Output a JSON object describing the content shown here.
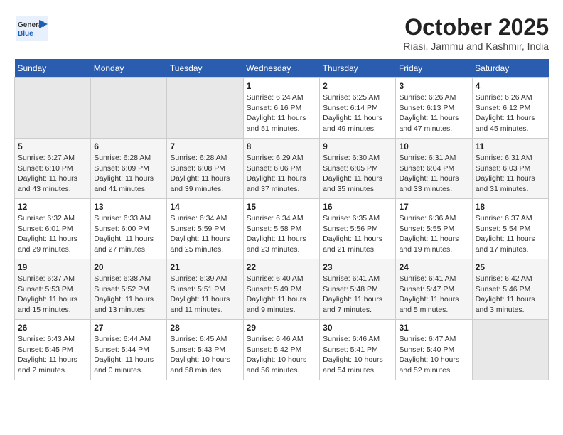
{
  "header": {
    "logo": {
      "general": "General",
      "blue": "Blue"
    },
    "title": "October 2025",
    "location": "Riasi, Jammu and Kashmir, India"
  },
  "calendar": {
    "days_of_week": [
      "Sunday",
      "Monday",
      "Tuesday",
      "Wednesday",
      "Thursday",
      "Friday",
      "Saturday"
    ],
    "weeks": [
      [
        {
          "day": "",
          "sunrise": "",
          "sunset": "",
          "daylight": ""
        },
        {
          "day": "",
          "sunrise": "",
          "sunset": "",
          "daylight": ""
        },
        {
          "day": "",
          "sunrise": "",
          "sunset": "",
          "daylight": ""
        },
        {
          "day": "1",
          "sunrise": "Sunrise: 6:24 AM",
          "sunset": "Sunset: 6:16 PM",
          "daylight": "Daylight: 11 hours and 51 minutes."
        },
        {
          "day": "2",
          "sunrise": "Sunrise: 6:25 AM",
          "sunset": "Sunset: 6:14 PM",
          "daylight": "Daylight: 11 hours and 49 minutes."
        },
        {
          "day": "3",
          "sunrise": "Sunrise: 6:26 AM",
          "sunset": "Sunset: 6:13 PM",
          "daylight": "Daylight: 11 hours and 47 minutes."
        },
        {
          "day": "4",
          "sunrise": "Sunrise: 6:26 AM",
          "sunset": "Sunset: 6:12 PM",
          "daylight": "Daylight: 11 hours and 45 minutes."
        }
      ],
      [
        {
          "day": "5",
          "sunrise": "Sunrise: 6:27 AM",
          "sunset": "Sunset: 6:10 PM",
          "daylight": "Daylight: 11 hours and 43 minutes."
        },
        {
          "day": "6",
          "sunrise": "Sunrise: 6:28 AM",
          "sunset": "Sunset: 6:09 PM",
          "daylight": "Daylight: 11 hours and 41 minutes."
        },
        {
          "day": "7",
          "sunrise": "Sunrise: 6:28 AM",
          "sunset": "Sunset: 6:08 PM",
          "daylight": "Daylight: 11 hours and 39 minutes."
        },
        {
          "day": "8",
          "sunrise": "Sunrise: 6:29 AM",
          "sunset": "Sunset: 6:06 PM",
          "daylight": "Daylight: 11 hours and 37 minutes."
        },
        {
          "day": "9",
          "sunrise": "Sunrise: 6:30 AM",
          "sunset": "Sunset: 6:05 PM",
          "daylight": "Daylight: 11 hours and 35 minutes."
        },
        {
          "day": "10",
          "sunrise": "Sunrise: 6:31 AM",
          "sunset": "Sunset: 6:04 PM",
          "daylight": "Daylight: 11 hours and 33 minutes."
        },
        {
          "day": "11",
          "sunrise": "Sunrise: 6:31 AM",
          "sunset": "Sunset: 6:03 PM",
          "daylight": "Daylight: 11 hours and 31 minutes."
        }
      ],
      [
        {
          "day": "12",
          "sunrise": "Sunrise: 6:32 AM",
          "sunset": "Sunset: 6:01 PM",
          "daylight": "Daylight: 11 hours and 29 minutes."
        },
        {
          "day": "13",
          "sunrise": "Sunrise: 6:33 AM",
          "sunset": "Sunset: 6:00 PM",
          "daylight": "Daylight: 11 hours and 27 minutes."
        },
        {
          "day": "14",
          "sunrise": "Sunrise: 6:34 AM",
          "sunset": "Sunset: 5:59 PM",
          "daylight": "Daylight: 11 hours and 25 minutes."
        },
        {
          "day": "15",
          "sunrise": "Sunrise: 6:34 AM",
          "sunset": "Sunset: 5:58 PM",
          "daylight": "Daylight: 11 hours and 23 minutes."
        },
        {
          "day": "16",
          "sunrise": "Sunrise: 6:35 AM",
          "sunset": "Sunset: 5:56 PM",
          "daylight": "Daylight: 11 hours and 21 minutes."
        },
        {
          "day": "17",
          "sunrise": "Sunrise: 6:36 AM",
          "sunset": "Sunset: 5:55 PM",
          "daylight": "Daylight: 11 hours and 19 minutes."
        },
        {
          "day": "18",
          "sunrise": "Sunrise: 6:37 AM",
          "sunset": "Sunset: 5:54 PM",
          "daylight": "Daylight: 11 hours and 17 minutes."
        }
      ],
      [
        {
          "day": "19",
          "sunrise": "Sunrise: 6:37 AM",
          "sunset": "Sunset: 5:53 PM",
          "daylight": "Daylight: 11 hours and 15 minutes."
        },
        {
          "day": "20",
          "sunrise": "Sunrise: 6:38 AM",
          "sunset": "Sunset: 5:52 PM",
          "daylight": "Daylight: 11 hours and 13 minutes."
        },
        {
          "day": "21",
          "sunrise": "Sunrise: 6:39 AM",
          "sunset": "Sunset: 5:51 PM",
          "daylight": "Daylight: 11 hours and 11 minutes."
        },
        {
          "day": "22",
          "sunrise": "Sunrise: 6:40 AM",
          "sunset": "Sunset: 5:49 PM",
          "daylight": "Daylight: 11 hours and 9 minutes."
        },
        {
          "day": "23",
          "sunrise": "Sunrise: 6:41 AM",
          "sunset": "Sunset: 5:48 PM",
          "daylight": "Daylight: 11 hours and 7 minutes."
        },
        {
          "day": "24",
          "sunrise": "Sunrise: 6:41 AM",
          "sunset": "Sunset: 5:47 PM",
          "daylight": "Daylight: 11 hours and 5 minutes."
        },
        {
          "day": "25",
          "sunrise": "Sunrise: 6:42 AM",
          "sunset": "Sunset: 5:46 PM",
          "daylight": "Daylight: 11 hours and 3 minutes."
        }
      ],
      [
        {
          "day": "26",
          "sunrise": "Sunrise: 6:43 AM",
          "sunset": "Sunset: 5:45 PM",
          "daylight": "Daylight: 11 hours and 2 minutes."
        },
        {
          "day": "27",
          "sunrise": "Sunrise: 6:44 AM",
          "sunset": "Sunset: 5:44 PM",
          "daylight": "Daylight: 11 hours and 0 minutes."
        },
        {
          "day": "28",
          "sunrise": "Sunrise: 6:45 AM",
          "sunset": "Sunset: 5:43 PM",
          "daylight": "Daylight: 10 hours and 58 minutes."
        },
        {
          "day": "29",
          "sunrise": "Sunrise: 6:46 AM",
          "sunset": "Sunset: 5:42 PM",
          "daylight": "Daylight: 10 hours and 56 minutes."
        },
        {
          "day": "30",
          "sunrise": "Sunrise: 6:46 AM",
          "sunset": "Sunset: 5:41 PM",
          "daylight": "Daylight: 10 hours and 54 minutes."
        },
        {
          "day": "31",
          "sunrise": "Sunrise: 6:47 AM",
          "sunset": "Sunset: 5:40 PM",
          "daylight": "Daylight: 10 hours and 52 minutes."
        },
        {
          "day": "",
          "sunrise": "",
          "sunset": "",
          "daylight": ""
        }
      ]
    ]
  }
}
